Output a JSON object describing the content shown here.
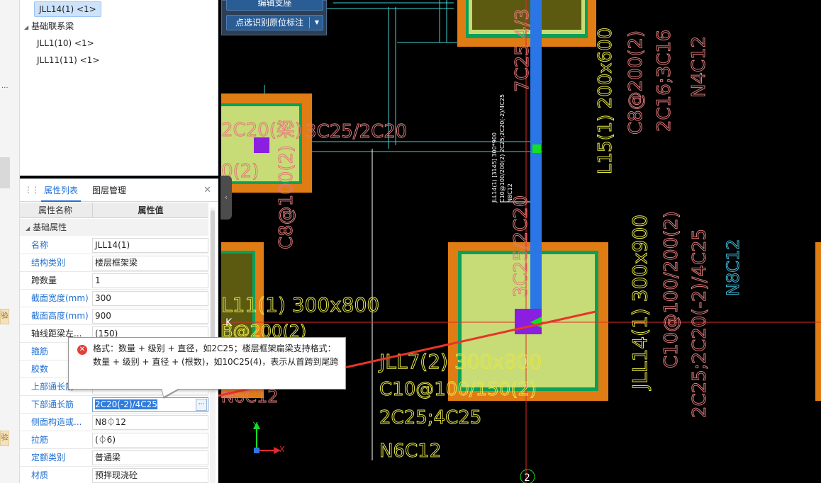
{
  "tree": {
    "items": [
      {
        "label": "JLL14(1) <1>",
        "selected": true
      },
      {
        "label": "基础联系梁",
        "group": true
      },
      {
        "label": "JLL1(10) <1>"
      },
      {
        "label": "JLL11(11) <1>"
      }
    ]
  },
  "left_strip": {
    "more": "...",
    "btn1": "验",
    "btn2": "验"
  },
  "toolbar": {
    "top_button": "编辑支座",
    "main_button": "点选识别原位标注"
  },
  "property_panel": {
    "tabs": [
      "属性列表",
      "图层管理"
    ],
    "header": [
      "属性名称",
      "属性值"
    ],
    "group": "基础属性",
    "rows": [
      {
        "name": "名称",
        "value": "JLL14(1)",
        "blue": true
      },
      {
        "name": "结构类别",
        "value": "楼层框架梁",
        "blue": true
      },
      {
        "name": "跨数量",
        "value": "1"
      },
      {
        "name": "截面宽度(mm)",
        "value": "300",
        "blue": true
      },
      {
        "name": "截面高度(mm)",
        "value": "900",
        "blue": true
      },
      {
        "name": "轴线距梁左...",
        "value": "(150)"
      },
      {
        "name": "箍筋",
        "value": "",
        "blue": true
      },
      {
        "name": "胶数",
        "value": "",
        "blue": true
      },
      {
        "name": "上部通长筋",
        "value": "",
        "blue": true
      },
      {
        "name": "下部通长筋",
        "value": "2C20(-2)/4C25",
        "blue": true,
        "editing": true
      },
      {
        "name": "侧面构造或...",
        "value": "N8⏀12",
        "blue": true
      },
      {
        "name": "拉筋",
        "value": "(⏀6)",
        "blue": true
      },
      {
        "name": "定额类别",
        "value": "普通梁",
        "blue": true
      },
      {
        "name": "材质",
        "value": "预拌现浇砼",
        "blue": true
      }
    ]
  },
  "tooltip": {
    "icon": "error-icon",
    "message": "格式：数量 + 级别 + 直径，如2C25；楼层框架扁梁支持格式：数量 + 级别 + 直径 + (根数)，如10C25(4)，表示从首跨到尾跨"
  },
  "cad": {
    "labels": {
      "pink_2c20": "2C20(梁)",
      "pink_3c25": "3C25/2C20",
      "pink_0_2": "0(2)",
      "pink_c8": "C8@100(2)",
      "pink_7c25": "7C25 4/3",
      "yellow_l15": "L15(1) 200x600",
      "pink_c8_200": "C8@200(2)",
      "pink_2c16": "2C16;3C16",
      "pink_n4c12": "N4C12",
      "yellow_l11": "L11(1) 300x800",
      "pink_k": "K",
      "yellow_b8": "B@200(2)",
      "pink_n6c12_left": "N6C12",
      "yellow_jll7": "JLL7(2) 300x800",
      "yellow_c10": "C10@100/150(2)",
      "yellow_2c25": "2C25;4C25",
      "yellow_n6c12": "N6C12",
      "pink_3c25_2c20": "3C25/2C20",
      "yellow_jll14": "JLL14(1) 300x900",
      "pink_c10": "C10@100/200(2)",
      "pink_2c25": "2C25;2C20(-2)/4C25",
      "cyan_n8c12": "N8C12",
      "white_small_1": "JLL14(1) [3145] 300*900",
      "white_small_2": "C10@100/200(2) 2C25;2C20(-2)/4C25",
      "white_small_3": "N8C12",
      "axis_x": "X",
      "axis_y": "Y",
      "grid_bubble": "2"
    }
  }
}
